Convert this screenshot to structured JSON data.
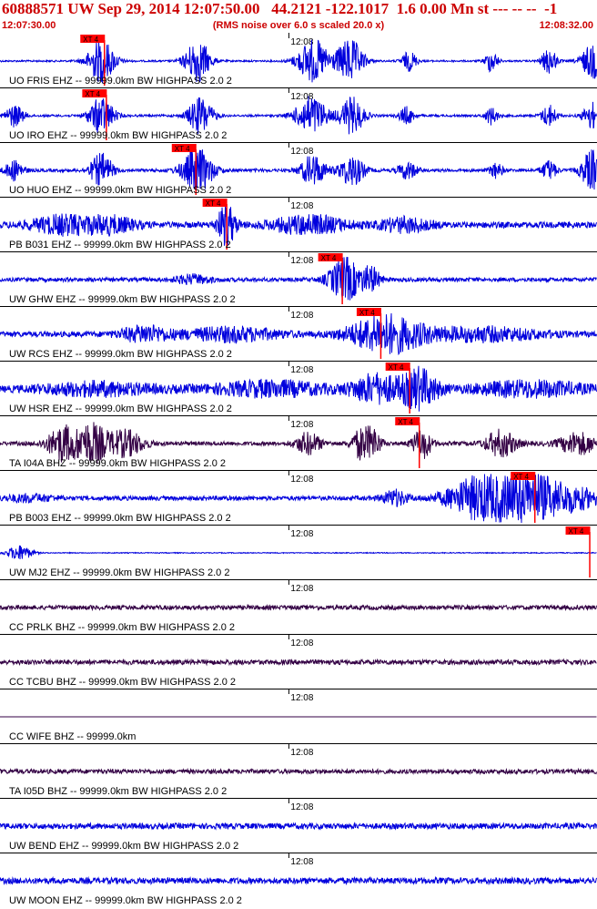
{
  "header": {
    "title": "60888571 UW Sep 29, 2014 12:07:50.00   44.2121 -122.1017  1.6 0.00 Mn st --- -- --  -1",
    "start_time": "12:07:30.00",
    "end_time": "12:08:32.00",
    "note": "(RMS noise over 6.0 s scaled 20.0 x)"
  },
  "colors": {
    "header_text": "#cc0000",
    "trace_blue": "#0000dd",
    "trace_purple": "#330044",
    "pick_marker": "#ff0000",
    "divider": "#000000"
  },
  "chart_data": {
    "type": "line",
    "title": "60888571 UW Sep 29, 2014 12:07:50.00   44.2121 -122.1017  1.6 0.00 Mn st --- -- --  -1",
    "x_range": [
      "12:07:30.00",
      "12:08:32.00"
    ],
    "x_tick_label": "12:08",
    "pick_label": "XT 4",
    "grid": false,
    "series": [
      {
        "name": "UO FRIS EHZ -- 99999.0km BW  HIGHPASS  2.0  2",
        "color": "#0000dd",
        "pick_time_s": 10.8,
        "bursts": [
          [
            10.5,
            2.2,
            1.0
          ],
          [
            20.5,
            2.0,
            1.0
          ],
          [
            32.5,
            2.5,
            1.0
          ],
          [
            36.3,
            2.2,
            1.0
          ],
          [
            42.5,
            1.2,
            0.45
          ],
          [
            51.0,
            1.0,
            0.5
          ],
          [
            57.0,
            1.2,
            0.6
          ],
          [
            61.5,
            1.8,
            0.8
          ]
        ],
        "noise": 0.04
      },
      {
        "name": "UO IRO EHZ -- 99999.0km BW  HIGHPASS  2.0  2",
        "color": "#0000dd",
        "pick_time_s": 11.0,
        "bursts": [
          [
            1.5,
            1.5,
            0.5
          ],
          [
            10.5,
            2.0,
            0.85
          ],
          [
            20.8,
            2.0,
            0.85
          ],
          [
            32.3,
            2.5,
            0.9
          ],
          [
            36.5,
            2.0,
            0.85
          ],
          [
            42.2,
            1.2,
            0.4
          ],
          [
            51.0,
            1.0,
            0.4
          ],
          [
            57.0,
            1.2,
            0.5
          ],
          [
            61.5,
            1.5,
            0.6
          ]
        ],
        "noise": 0.05
      },
      {
        "name": "UO HUO EHZ -- 99999.0km BW  HIGHPASS  2.0  2",
        "color": "#0000dd",
        "pick_time_s": 20.3,
        "bursts": [
          [
            1.5,
            1.5,
            0.45
          ],
          [
            10.5,
            1.8,
            0.75
          ],
          [
            20.5,
            2.5,
            1.0
          ],
          [
            32.5,
            2.0,
            0.7
          ],
          [
            36.5,
            2.0,
            0.7
          ],
          [
            42.3,
            1.5,
            0.4
          ],
          [
            51.5,
            1.0,
            0.35
          ],
          [
            57.0,
            1.2,
            0.45
          ],
          [
            61.5,
            1.8,
            0.9
          ]
        ],
        "noise": 0.07
      },
      {
        "name": "PB B031 EHZ -- 99999.0km BW  HIGHPASS  2.0  2",
        "color": "#0000dd",
        "pick_time_s": 23.5,
        "bursts": [
          [
            6.5,
            5.0,
            0.4
          ],
          [
            11.5,
            4.0,
            0.35
          ],
          [
            23.5,
            1.5,
            0.9
          ],
          [
            32.0,
            6.0,
            0.4
          ],
          [
            42.0,
            4.0,
            0.3
          ]
        ],
        "noise": 0.14
      },
      {
        "name": "UW GHW EHZ -- 99999.0km BW  HIGHPASS  2.0  2",
        "color": "#0000dd",
        "pick_time_s": 35.5,
        "bursts": [
          [
            35.8,
            2.5,
            1.0
          ],
          [
            38.5,
            1.5,
            0.55
          ],
          [
            20.0,
            3.0,
            0.2
          ]
        ],
        "noise": 0.09
      },
      {
        "name": "UW RCS EHZ -- 99999.0km BW  HIGHPASS  2.0  2",
        "color": "#0000dd",
        "pick_time_s": 39.5,
        "bursts": [
          [
            15.0,
            4.0,
            0.35
          ],
          [
            24.0,
            8.0,
            0.3
          ],
          [
            40.0,
            6.0,
            0.85
          ],
          [
            50.0,
            10.0,
            0.3
          ]
        ],
        "noise": 0.12
      },
      {
        "name": "UW HSR EHZ -- 99999.0km BW  HIGHPASS  2.0  2",
        "color": "#0000dd",
        "pick_time_s": 42.5,
        "bursts": [
          [
            10.0,
            10.0,
            0.3
          ],
          [
            28.0,
            10.0,
            0.35
          ],
          [
            39.0,
            4.0,
            0.65
          ],
          [
            43.5,
            3.0,
            0.9
          ],
          [
            55.0,
            10.0,
            0.35
          ]
        ],
        "noise": 0.12
      },
      {
        "name": "TA I04A BHZ -- 99999.0km BW  HIGHPASS  2.0  2",
        "color": "#330044",
        "pick_time_s": 43.5,
        "bursts": [
          [
            6.5,
            2.5,
            0.8
          ],
          [
            9.5,
            2.5,
            0.9
          ],
          [
            13.0,
            3.0,
            0.6
          ],
          [
            32.0,
            2.0,
            0.5
          ],
          [
            37.5,
            1.5,
            0.7
          ],
          [
            38.8,
            1.2,
            0.6
          ],
          [
            43.8,
            1.5,
            0.7
          ],
          [
            52.0,
            2.5,
            0.6
          ],
          [
            60.0,
            3.0,
            0.5
          ]
        ],
        "noise": 0.09
      },
      {
        "name": "PB B003 EHZ -- 99999.0km BW  HIGHPASS  2.0  2",
        "color": "#0000dd",
        "pick_time_s": 55.5,
        "bursts": [
          [
            41.0,
            2.0,
            0.35
          ],
          [
            50.0,
            5.5,
            1.0
          ],
          [
            55.5,
            5.0,
            1.0
          ],
          [
            60.0,
            4.0,
            0.4
          ],
          [
            3.0,
            4.0,
            0.15
          ]
        ],
        "noise": 0.1
      },
      {
        "name": "UW MJ2 EHZ -- 99999.0km BW  HIGHPASS  2.0  2",
        "color": "#0000dd",
        "pick_time_s": 61.2,
        "bursts": [
          [
            2.0,
            2.0,
            0.35
          ]
        ],
        "noise": 0.02
      },
      {
        "name": "CC PRLK BHZ -- 99999.0km BW  HIGHPASS  2.0  2",
        "color": "#330044",
        "pick_time_s": null,
        "bursts": [],
        "noise": 0.1
      },
      {
        "name": "CC TCBU BHZ -- 99999.0km BW  HIGHPASS  2.0  2",
        "color": "#330044",
        "pick_time_s": null,
        "bursts": [],
        "noise": 0.11
      },
      {
        "name": "CC WIFE BHZ -- 99999.0km",
        "color": "#330044",
        "pick_time_s": null,
        "bursts": [],
        "noise": 0.0
      },
      {
        "name": "TA I05D BHZ -- 99999.0km BW  HIGHPASS  2.0  2",
        "color": "#330044",
        "pick_time_s": null,
        "bursts": [],
        "noise": 0.1
      },
      {
        "name": "UW BEND EHZ -- 99999.0km BW  HIGHPASS  2.0  2",
        "color": "#0000dd",
        "pick_time_s": null,
        "bursts": [],
        "noise": 0.13
      },
      {
        "name": "UW MOON EHZ -- 99999.0km BW  HIGHPASS  2.0  2",
        "color": "#0000dd",
        "pick_time_s": null,
        "bursts": [],
        "noise": 0.14
      }
    ]
  }
}
